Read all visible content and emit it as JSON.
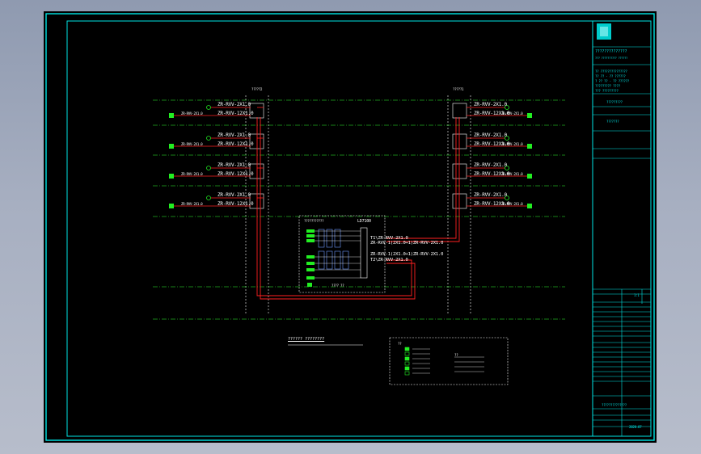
{
  "diagram": {
    "left_group_tag": "?????2",
    "right_group_tag": "?????1",
    "cable_main": "ZR-RVV-2X1.0",
    "cable_branch": "ZR-RVV-12X1.0",
    "panel_title": "LD7100",
    "panel_header": "???????????",
    "panel_footer": "???? ??",
    "trunk_lines": [
      "T1\\ZR-RVV-2X1.0",
      "ZR-RVV-1(2X1.0+1)ZR-RVV-2X1.0",
      "ZR-RVV-1(2X1.0+1)ZR-RVV-2X1.0",
      "T2\\ZR-RVV-2X1.0"
    ],
    "diagram_title": "?????? ????????",
    "legend_header": "??",
    "legend_right_header": "??"
  },
  "title_block": {
    "company": "??????????????",
    "company_sub": "??? ?????????? ??????",
    "rows": [
      "?? ???????????????",
      "?? ?? - ?? ??????",
      "? ?? ?? - ?? ??????",
      "????????? ????",
      "??? ?????????"
    ],
    "project": "?????????",
    "drawing_name": "???????",
    "bottom_code": "??????????????",
    "scale": "1:1",
    "date": "2020.07"
  },
  "colors": {
    "background": "#000000",
    "frame": "#00e5e5",
    "grid": "#33ff33",
    "wire": "#ff2020",
    "device": "#ffffff",
    "green_block": "#22ee22"
  }
}
